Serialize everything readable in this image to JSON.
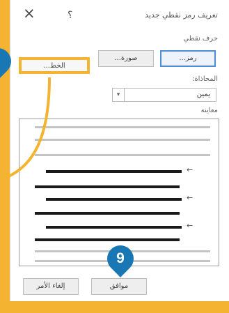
{
  "dialog": {
    "title": "تعريف رمز نقطي جديد",
    "close_glyph": "×",
    "help_glyph": "؟",
    "char_section_label": "حرف نقطي",
    "symbol_button": "رمز...",
    "picture_button": "صورة...",
    "font_button": "الخط...",
    "alignment_label": "المحاذاة:",
    "alignment_value": "يمين",
    "preview_label": "معاينة",
    "ok_button": "موافق",
    "cancel_button": "إلغاء الأمر"
  },
  "annotations": {
    "step_9": "9"
  },
  "colors": {
    "highlight": "#f4b431",
    "marker": "#1978b3",
    "selected_border": "#4a8fd6"
  }
}
